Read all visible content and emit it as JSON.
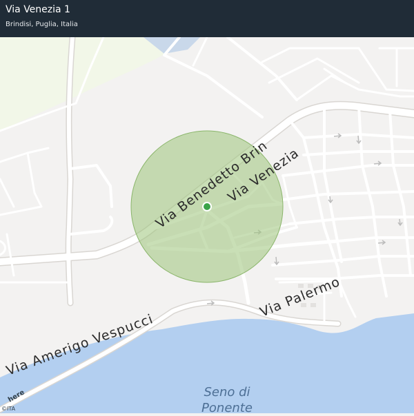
{
  "header": {
    "title": "Via Venezia 1",
    "subtitle": "Brindisi, Puglia, Italia"
  },
  "map": {
    "road_labels": {
      "via_benedetto_brin": "Via Benedetto Brin",
      "via_venezia": "Via Venezia",
      "via_palermo": "Via Palermo",
      "via_amerigo_vespucci": "Via Amerigo Vespucci"
    },
    "water_label_line1": "Seno di",
    "water_label_line2": "Ponente",
    "brand": "here",
    "country_code": "©ITA",
    "colors": {
      "land": "#f3f2f1",
      "park": "#f2f7e8",
      "water": "#b3cff0",
      "road": "#ffffff",
      "road_casing": "#d9d6d2",
      "accuracy_circle": "#9cc47a",
      "location_dot": "#3ba349",
      "header_bg": "#202c37"
    }
  }
}
